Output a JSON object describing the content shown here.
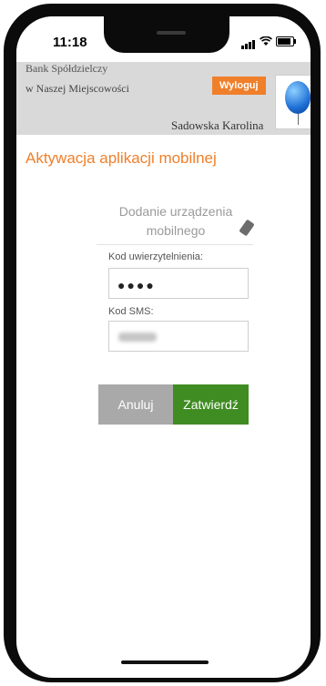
{
  "status_bar": {
    "time": "11:18"
  },
  "header": {
    "bank_line1": "Bank Spółdzielczy",
    "bank_line2": "w Naszej Miejscowości",
    "logout_label": "Wyloguj",
    "username": "Sadowska Karolina"
  },
  "page": {
    "title": "Aktywacja aplikacji mobilnej",
    "section_title": "Dodanie urządzenia mobilnego"
  },
  "form": {
    "auth_code_label": "Kod uwierzytelnienia:",
    "auth_code_value": "●●●●",
    "sms_code_label": "Kod SMS:"
  },
  "buttons": {
    "cancel_label": "Anuluj",
    "confirm_label": "Zatwierdź"
  },
  "colors": {
    "accent": "#f07f2a",
    "confirm": "#3f8c22",
    "cancel": "#a9a9a9",
    "header_bg": "#d9d9d9"
  }
}
